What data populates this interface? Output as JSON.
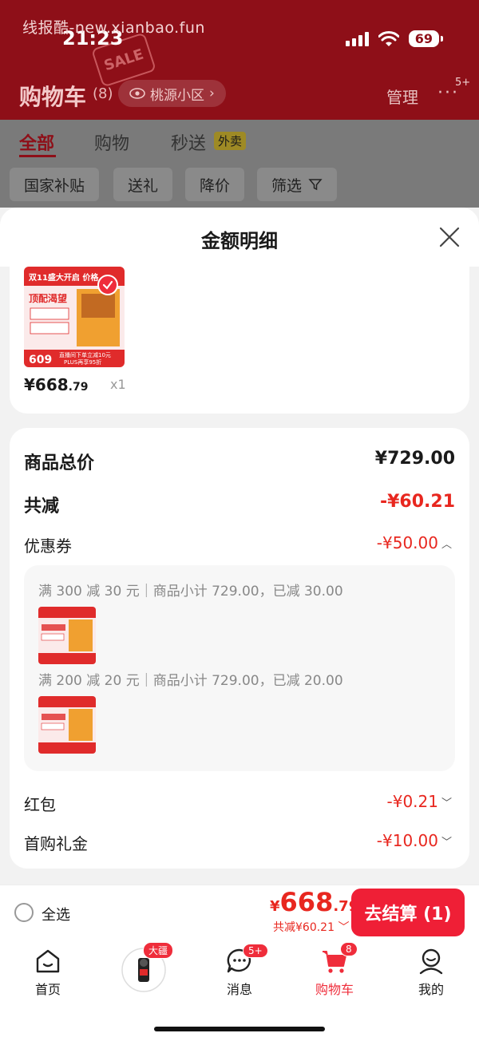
{
  "watermark": "线报酷-new.xianbao.fun",
  "status_bar": {
    "time": "21:23",
    "battery": "69"
  },
  "header": {
    "title": "购物车",
    "count": "(8)",
    "location": "桃源小区",
    "manage": "管理",
    "more_badge": "5+"
  },
  "tabs": [
    {
      "label": "全部"
    },
    {
      "label": "购物"
    },
    {
      "label": "秒送"
    }
  ],
  "waimai_tag": "外卖",
  "filter_chips": [
    {
      "label": "国家补贴"
    },
    {
      "label": "送礼"
    },
    {
      "label": "降价"
    },
    {
      "label": "筛选"
    }
  ],
  "sheet": {
    "title": "金额明细",
    "product": {
      "price_int": "¥668",
      "price_dec": ".79",
      "qty": "x1",
      "image_texts": [
        "双11盛大开启 价格",
        "顶配渴望",
        "609",
        "直播间下单立减10元",
        "PLUS再享95折"
      ]
    },
    "summary": {
      "goods_total_label": "商品总价",
      "goods_total_value": "¥729.00",
      "discount_label": "共减",
      "discount_value": "-¥60.21",
      "coupon_label": "优惠券",
      "coupon_value": "-¥50.00",
      "coupons": [
        {
          "text": "满 300 减 30 元｜商品小计 729.00，已减 30.00"
        },
        {
          "text": "满 200 减 20 元｜商品小计 729.00，已减 20.00"
        }
      ],
      "redpacket_label": "红包",
      "redpacket_value": "-¥0.21",
      "gift_label": "首购礼金",
      "gift_value": "-¥10.00"
    }
  },
  "checkout": {
    "select_all": "全选",
    "currency": "¥",
    "total_int": "668",
    "total_dec": ".79",
    "saved": "共减¥60.21",
    "button": "去结算 (1)"
  },
  "tabbar": {
    "home": "首页",
    "dajiang_badge": "大疆",
    "messages": "消息",
    "messages_badge": "5+",
    "cart": "购物车",
    "cart_badge": "8",
    "me": "我的"
  },
  "colors": {
    "accent": "#e8271f",
    "brand_red": "#ef1f36",
    "header_dim": "#8e0f18"
  }
}
